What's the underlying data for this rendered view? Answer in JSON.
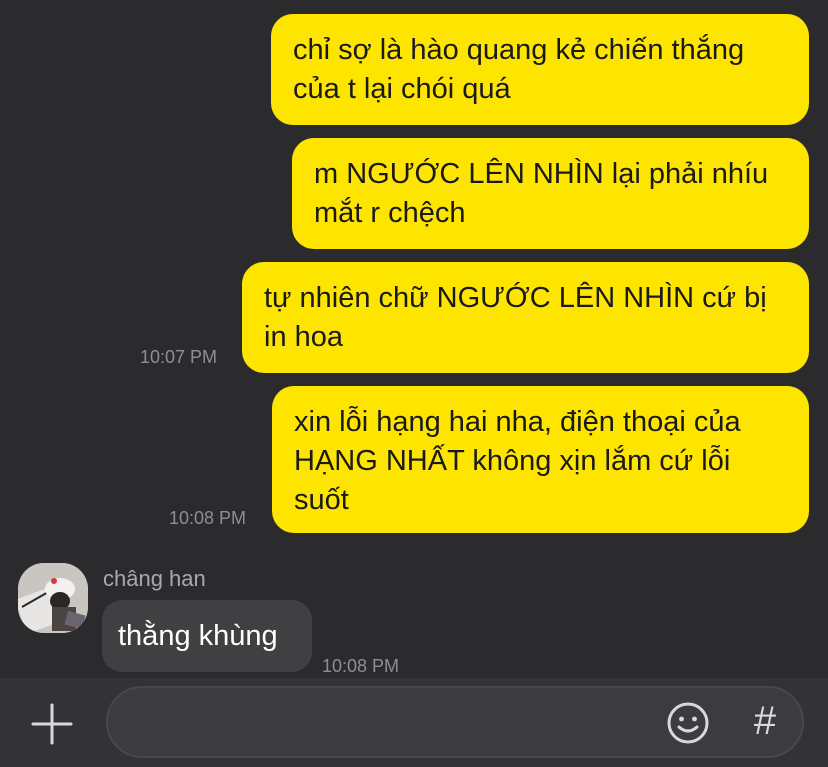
{
  "messages": [
    {
      "text": "chỉ sợ là hào quang kẻ chiến thắng\ncủa t lại chói quá"
    },
    {
      "text": "m NGƯỚC LÊN NHÌN lại phải nhíu\nmắt r chệch"
    },
    {
      "text": "tự nhiên chữ NGƯỚC LÊN NHÌN cứ bị\nin hoa",
      "time": "10:07 PM"
    },
    {
      "text": "xin lỗi hạng hai nha, điện thoại của\nHẠNG NHẤT không xịn lắm cứ lỗi\nsuốt",
      "time": "10:08 PM"
    }
  ],
  "incoming": {
    "sender": "châng han",
    "text": "thằng khùng",
    "time": "10:08 PM"
  },
  "input_bar": {
    "plus_icon": "plus-icon",
    "emoji_icon": "emoji-icon",
    "hash_label": "#"
  },
  "colors": {
    "background": "#2b2b2d",
    "outgoing_bubble": "#fee500",
    "incoming_bubble": "#404043",
    "timestamp": "#8f8f93"
  }
}
